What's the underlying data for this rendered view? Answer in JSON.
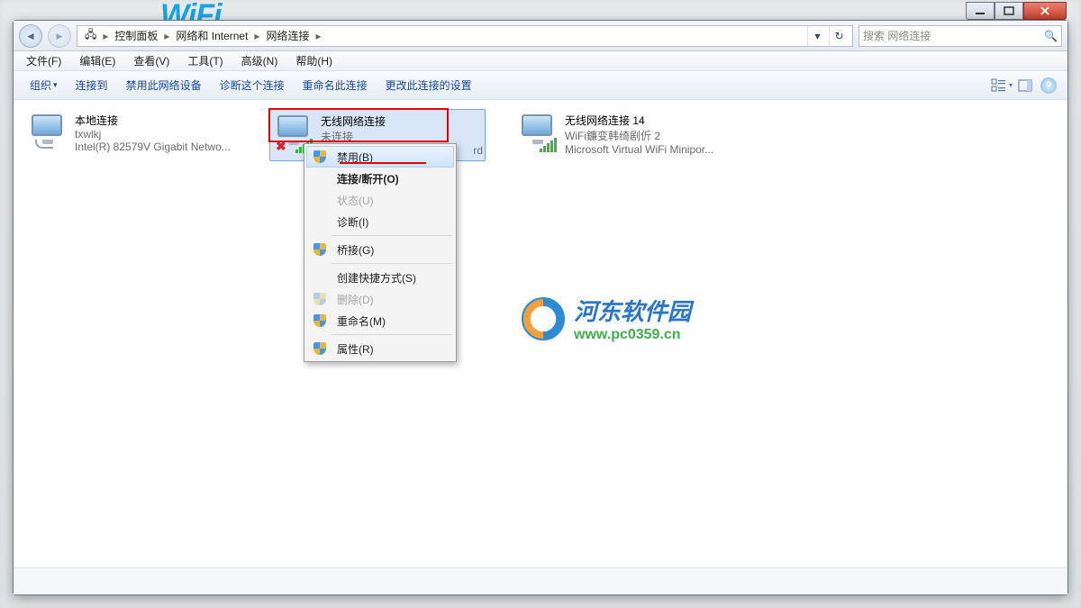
{
  "window_controls": {
    "min": "minimize",
    "max": "maximize",
    "close": "close"
  },
  "breadcrumbs": [
    "控制面板",
    "网络和 Internet",
    "网络连接"
  ],
  "search": {
    "placeholder": "搜索 网络连接"
  },
  "menubar": [
    "文件(F)",
    "编辑(E)",
    "查看(V)",
    "工具(T)",
    "高级(N)",
    "帮助(H)"
  ],
  "commandbar": {
    "organize": "组织",
    "items": [
      "连接到",
      "禁用此网络设备",
      "诊断这个连接",
      "重命名此连接",
      "更改此连接的设置"
    ]
  },
  "connections": [
    {
      "title": "本地连接",
      "status": "txwlkj",
      "device": "Intel(R) 82579V Gigabit Netwo..."
    },
    {
      "title": "无线网络连接",
      "status": "未连接",
      "device": "rd"
    },
    {
      "title": "无线网络连接 14",
      "status": "WiFi鐮变韩绮剧伒  2",
      "device": "Microsoft Virtual WiFi Minipor..."
    }
  ],
  "context_menu": {
    "disable": "禁用(B)",
    "disconnect": "连接/断开(O)",
    "status": "状态(U)",
    "diagnose": "诊断(I)",
    "bridge": "桥接(G)",
    "shortcut": "创建快捷方式(S)",
    "delete": "删除(D)",
    "rename": "重命名(M)",
    "properties": "属性(R)"
  },
  "watermark": {
    "title": "河东软件园",
    "url": "www.pc0359.cn"
  }
}
